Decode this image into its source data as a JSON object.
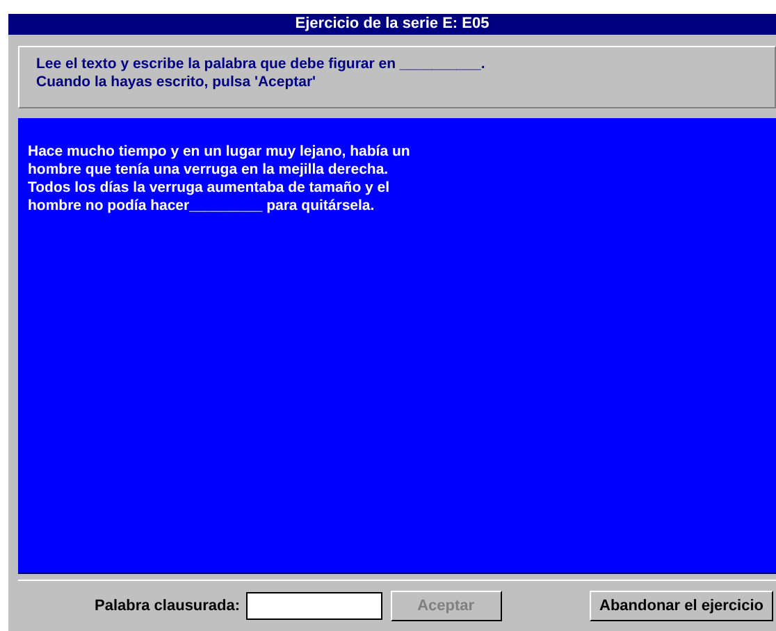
{
  "window": {
    "title": "Ejercicio de la serie E: E05"
  },
  "instructions": [
    "Lee el texto y escribe la palabra que debe figurar en __________.",
    "Cuando la hayas escrito, pulsa 'Aceptar'"
  ],
  "passage": [
    "Hace mucho tiempo y en un lugar muy lejano, había un",
    "hombre que tenía una verruga en la mejilla derecha.",
    "Todos los días la verruga aumentaba de tamaño y el",
    "hombre no podía hacer_________  para quitársela."
  ],
  "answer": {
    "label": "Palabra clausurada:"
  },
  "buttons": [
    {
      "label": "Aceptar",
      "disabled": true
    },
    {
      "label": "Abandonar el ejercicio",
      "disabled": false
    }
  ]
}
